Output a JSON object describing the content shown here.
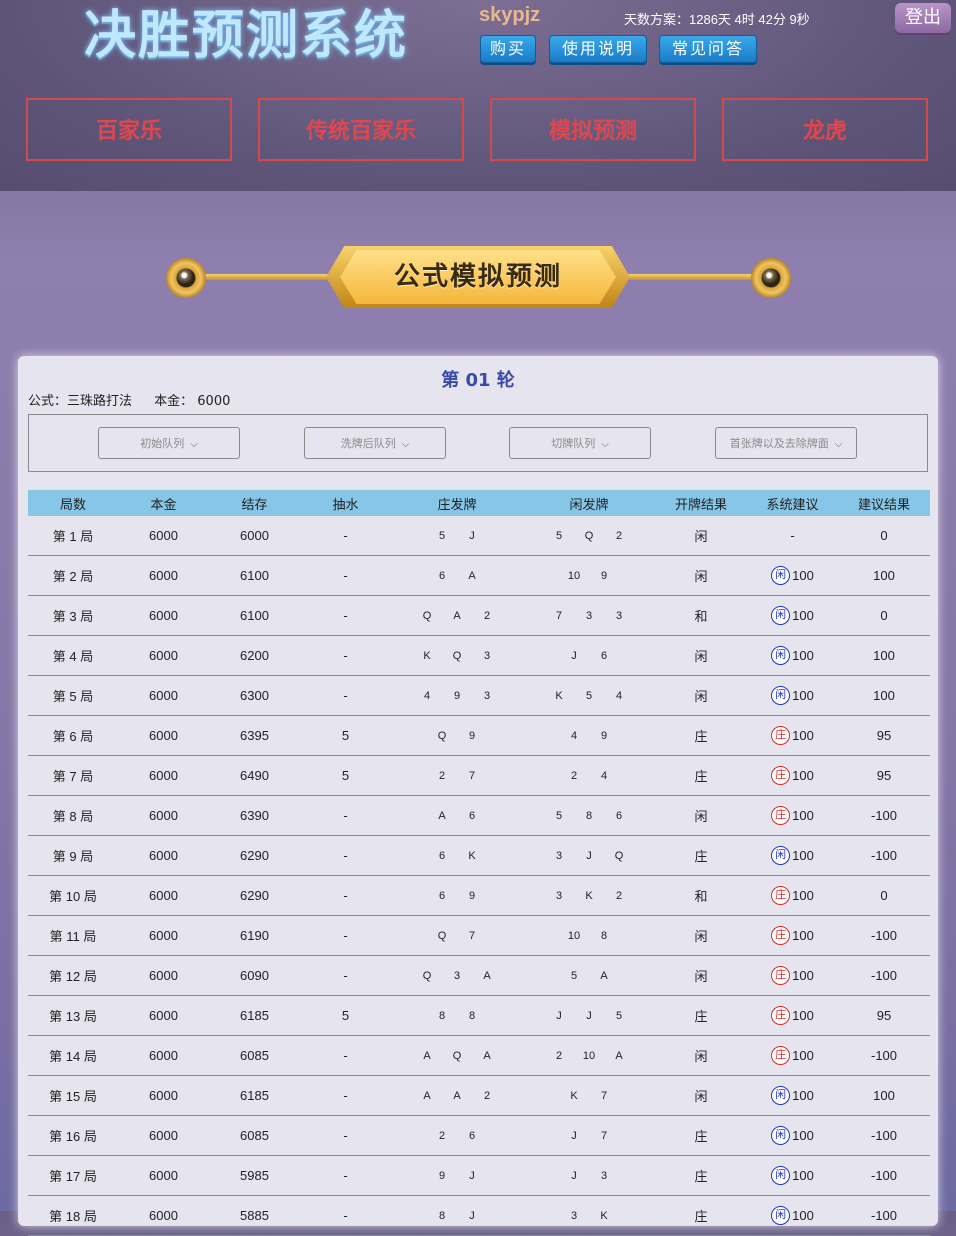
{
  "header": {
    "app_title": "决胜预测系统",
    "username": "skypjz",
    "days_plan": "天数方案：1286天 4时 42分 9秒",
    "logout_label": "登出",
    "buttons": [
      "购买",
      "使用说明",
      "常见问答"
    ],
    "nav": [
      "百家乐",
      "传统百家乐",
      "模拟预测",
      "龙虎"
    ]
  },
  "banner": {
    "title": "公式模拟预测"
  },
  "panel": {
    "round_title": "第 01 轮",
    "formula_label": "公式：三珠路打法",
    "capital_label": "本金： 6000",
    "dropdowns": [
      "初始队列",
      "洗牌后队列",
      "切牌队列",
      "首张牌以及去除牌面"
    ]
  },
  "table": {
    "headers": [
      "局数",
      "本金",
      "结存",
      "抽水",
      "庄发牌",
      "闲发牌",
      "开牌结果",
      "系统建议",
      "建议结果"
    ],
    "rows": [
      {
        "round": "第 1 局",
        "capital": "6000",
        "balance": "6000",
        "rake": "-",
        "banker": [
          "5",
          "J"
        ],
        "player": [
          "5",
          "Q",
          "2"
        ],
        "result": "闲",
        "advice_side": "",
        "advice_amt": "-",
        "outcome": "0",
        "outcome_color": "dark"
      },
      {
        "round": "第 2 局",
        "capital": "6000",
        "balance": "6100",
        "rake": "-",
        "banker": [
          "6",
          "A"
        ],
        "player": [
          "10",
          "9"
        ],
        "result": "闲",
        "advice_side": "闲",
        "advice_amt": "100",
        "outcome": "100",
        "outcome_color": "white"
      },
      {
        "round": "第 3 局",
        "capital": "6000",
        "balance": "6100",
        "rake": "-",
        "banker": [
          "Q",
          "A",
          "2"
        ],
        "player": [
          "7",
          "3",
          "3"
        ],
        "result": "和",
        "advice_side": "闲",
        "advice_amt": "100",
        "outcome": "0",
        "outcome_color": "dark"
      },
      {
        "round": "第 4 局",
        "capital": "6000",
        "balance": "6200",
        "rake": "-",
        "banker": [
          "K",
          "Q",
          "3"
        ],
        "player": [
          "J",
          "6"
        ],
        "result": "闲",
        "advice_side": "闲",
        "advice_amt": "100",
        "outcome": "100",
        "outcome_color": "white"
      },
      {
        "round": "第 5 局",
        "capital": "6000",
        "balance": "6300",
        "rake": "-",
        "banker": [
          "4",
          "9",
          "3"
        ],
        "player": [
          "K",
          "5",
          "4"
        ],
        "result": "闲",
        "advice_side": "闲",
        "advice_amt": "100",
        "outcome": "100",
        "outcome_color": "white"
      },
      {
        "round": "第 6 局",
        "capital": "6000",
        "balance": "6395",
        "rake": "5",
        "banker": [
          "Q",
          "9"
        ],
        "player": [
          "4",
          "9"
        ],
        "result": "庄",
        "advice_side": "庄",
        "advice_amt": "100",
        "outcome": "95",
        "outcome_color": "white"
      },
      {
        "round": "第 7 局",
        "capital": "6000",
        "balance": "6490",
        "rake": "5",
        "banker": [
          "2",
          "7"
        ],
        "player": [
          "2",
          "4"
        ],
        "result": "庄",
        "advice_side": "庄",
        "advice_amt": "100",
        "outcome": "95",
        "outcome_color": "white"
      },
      {
        "round": "第 8 局",
        "capital": "6000",
        "balance": "6390",
        "rake": "-",
        "banker": [
          "A",
          "6"
        ],
        "player": [
          "5",
          "8",
          "6"
        ],
        "result": "闲",
        "advice_side": "庄",
        "advice_amt": "100",
        "outcome": "-100",
        "outcome_color": "green"
      },
      {
        "round": "第 9 局",
        "capital": "6000",
        "balance": "6290",
        "rake": "-",
        "banker": [
          "6",
          "K"
        ],
        "player": [
          "3",
          "J",
          "Q"
        ],
        "result": "庄",
        "advice_side": "闲",
        "advice_amt": "100",
        "outcome": "-100",
        "outcome_color": "green"
      },
      {
        "round": "第 10 局",
        "capital": "6000",
        "balance": "6290",
        "rake": "-",
        "banker": [
          "6",
          "9"
        ],
        "player": [
          "3",
          "K",
          "2"
        ],
        "result": "和",
        "advice_side": "庄",
        "advice_amt": "100",
        "outcome": "0",
        "outcome_color": "dark"
      },
      {
        "round": "第 11 局",
        "capital": "6000",
        "balance": "6190",
        "rake": "-",
        "banker": [
          "Q",
          "7"
        ],
        "player": [
          "10",
          "8"
        ],
        "result": "闲",
        "advice_side": "庄",
        "advice_amt": "100",
        "outcome": "-100",
        "outcome_color": "green"
      },
      {
        "round": "第 12 局",
        "capital": "6000",
        "balance": "6090",
        "rake": "-",
        "banker": [
          "Q",
          "3",
          "A"
        ],
        "player": [
          "5",
          "A"
        ],
        "result": "闲",
        "advice_side": "庄",
        "advice_amt": "100",
        "outcome": "-100",
        "outcome_color": "green"
      },
      {
        "round": "第 13 局",
        "capital": "6000",
        "balance": "6185",
        "rake": "5",
        "banker": [
          "8",
          "8"
        ],
        "player": [
          "J",
          "J",
          "5"
        ],
        "result": "庄",
        "advice_side": "庄",
        "advice_amt": "100",
        "outcome": "95",
        "outcome_color": "white"
      },
      {
        "round": "第 14 局",
        "capital": "6000",
        "balance": "6085",
        "rake": "-",
        "banker": [
          "A",
          "Q",
          "A"
        ],
        "player": [
          "2",
          "10",
          "A"
        ],
        "result": "闲",
        "advice_side": "庄",
        "advice_amt": "100",
        "outcome": "-100",
        "outcome_color": "green"
      },
      {
        "round": "第 15 局",
        "capital": "6000",
        "balance": "6185",
        "rake": "-",
        "banker": [
          "A",
          "A",
          "2"
        ],
        "player": [
          "K",
          "7"
        ],
        "result": "闲",
        "advice_side": "闲",
        "advice_amt": "100",
        "outcome": "100",
        "outcome_color": "white"
      },
      {
        "round": "第 16 局",
        "capital": "6000",
        "balance": "6085",
        "rake": "-",
        "banker": [
          "2",
          "6"
        ],
        "player": [
          "J",
          "7"
        ],
        "result": "庄",
        "advice_side": "闲",
        "advice_amt": "100",
        "outcome": "-100",
        "outcome_color": "green"
      },
      {
        "round": "第 17 局",
        "capital": "6000",
        "balance": "5985",
        "rake": "-",
        "banker": [
          "9",
          "J"
        ],
        "player": [
          "J",
          "3"
        ],
        "result": "庄",
        "advice_side": "闲",
        "advice_amt": "100",
        "outcome": "-100",
        "outcome_color": "green"
      },
      {
        "round": "第 18 局",
        "capital": "6000",
        "balance": "5885",
        "rake": "-",
        "banker": [
          "8",
          "J"
        ],
        "player": [
          "3",
          "K"
        ],
        "result": "庄",
        "advice_side": "闲",
        "advice_amt": "100",
        "outcome": "-100",
        "outcome_color": "green"
      }
    ]
  },
  "colors": {
    "nav_border": "#d34a4e",
    "header_cell": "#87c6e6",
    "player_circle": "#2230c8",
    "banker_circle": "#d42a2a",
    "loss_green": "#2fa82f"
  }
}
